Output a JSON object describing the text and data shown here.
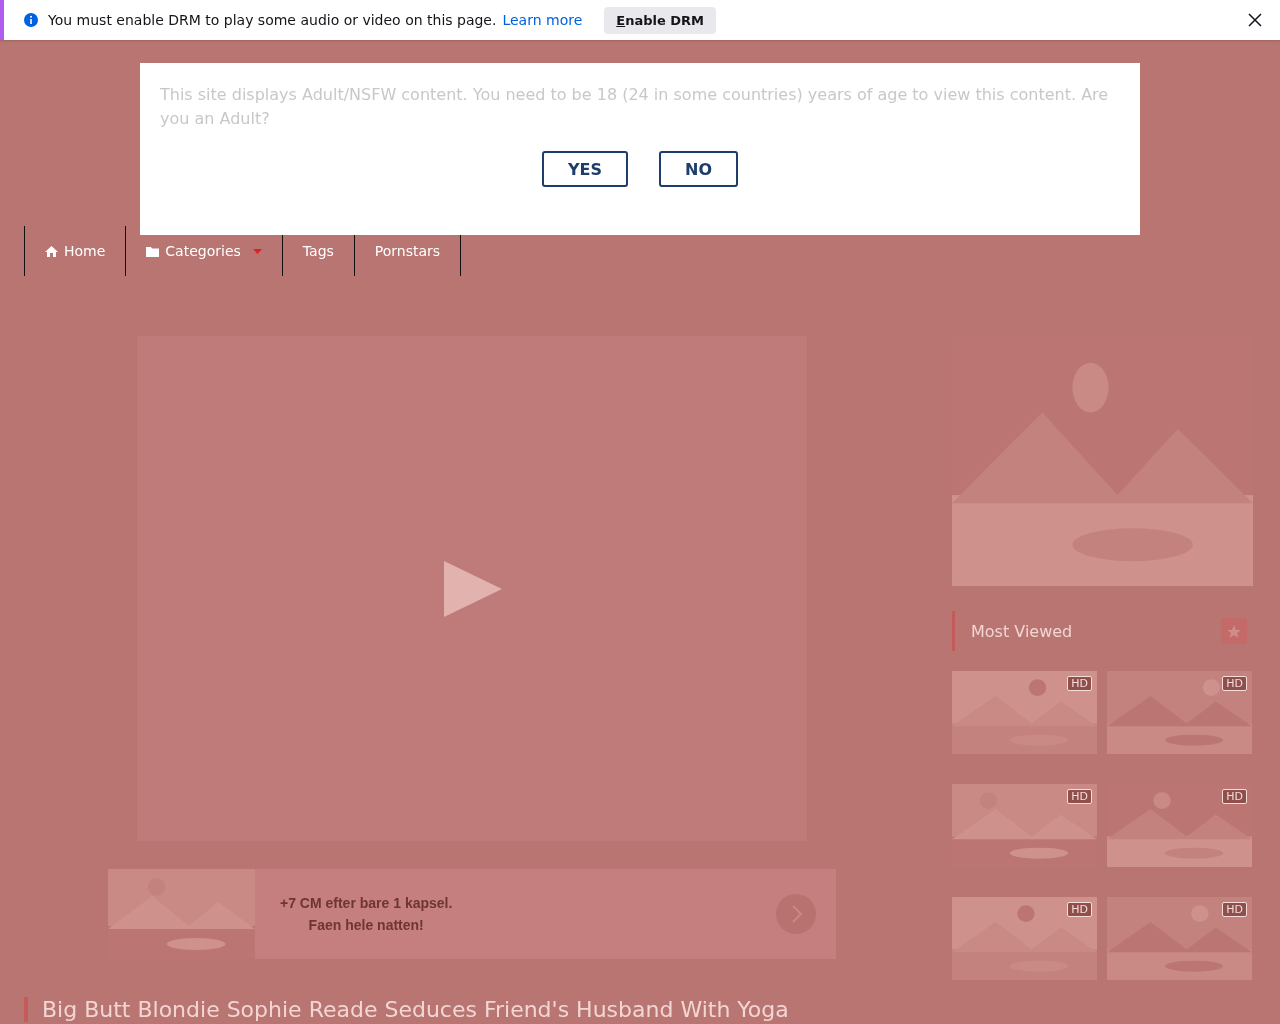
{
  "notification": {
    "message": "You must enable DRM to play some audio or video on this page.",
    "link": "Learn more",
    "button": "Enable DRM"
  },
  "age_gate": {
    "message": "This site displays Adult/NSFW content. You need to be 18 (24 in some countries) years of age to view this content. Are you an Adult?",
    "buttons": [
      "YES",
      "NO"
    ]
  },
  "nav": [
    {
      "label": "Home",
      "kind": "home"
    },
    {
      "label": "Categories",
      "kind": "dropdown"
    },
    {
      "label": "Tags",
      "kind": "plain"
    },
    {
      "label": "Pornstars",
      "kind": "plain"
    }
  ],
  "ad": {
    "lines": [
      "+7 CM efter bare 1 kapsel.",
      "Faen hele natten!"
    ]
  },
  "video_title": "Big Butt Blondie Sophie Reade Seduces Friend's Husband With Yoga",
  "sidebar": {
    "heading": "Most Viewed",
    "thumbnails": [
      {
        "badge": "HD"
      },
      {
        "badge": "HD"
      },
      {
        "badge": "HD"
      },
      {
        "badge": "HD"
      },
      {
        "badge": "HD"
      },
      {
        "badge": "HD"
      }
    ]
  }
}
